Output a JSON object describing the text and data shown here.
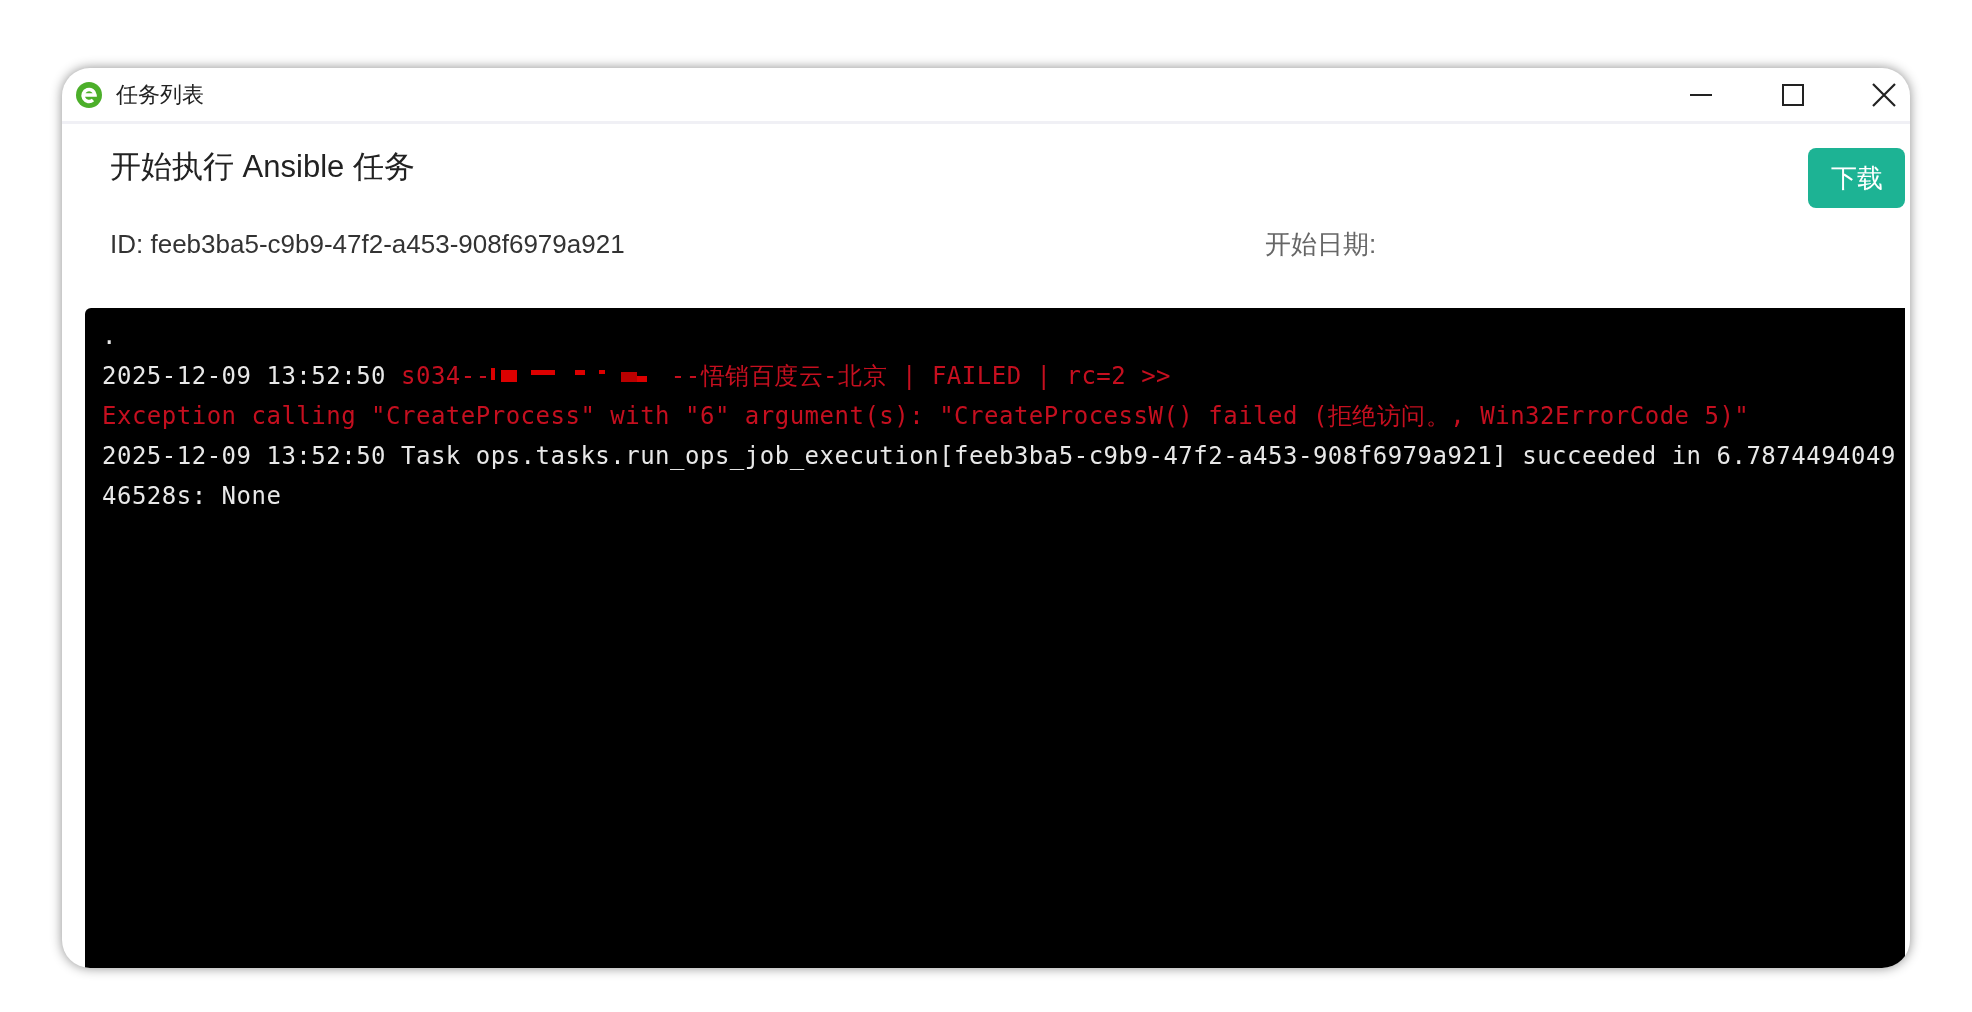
{
  "window": {
    "title": "任务列表"
  },
  "header": {
    "title": "开始执行 Ansible 任务",
    "id_label": "ID: feeb3ba5-c9b9-47f2-a453-908f6979a921",
    "start_date_label": "开始日期:",
    "download_button": "下载"
  },
  "console": {
    "lines": [
      [
        {
          "kind": "normal",
          "text": "."
        }
      ],
      [
        {
          "kind": "normal",
          "text": "2025-12-09 13:52:50 "
        },
        {
          "kind": "error",
          "text": "s034--"
        },
        {
          "kind": "redaction"
        },
        {
          "kind": "error",
          "text": "--悟销百度云-北京 | FAILED | rc=2 >>"
        }
      ],
      [
        {
          "kind": "error",
          "text": "Exception calling \"CreateProcess\" with \"6\" argument(s): \"CreateProcessW() failed (拒绝访问。, Win32ErrorCode 5)\""
        }
      ],
      [
        {
          "kind": "normal",
          "text": "2025-12-09 13:52:50 Task ops.tasks.run_ops_job_execution[feeb3ba5-c9b9-47f2-a453-908f6979a921] succeeded in 6.7874494049"
        }
      ],
      [
        {
          "kind": "normal",
          "text": "46528s: None"
        }
      ]
    ]
  }
}
